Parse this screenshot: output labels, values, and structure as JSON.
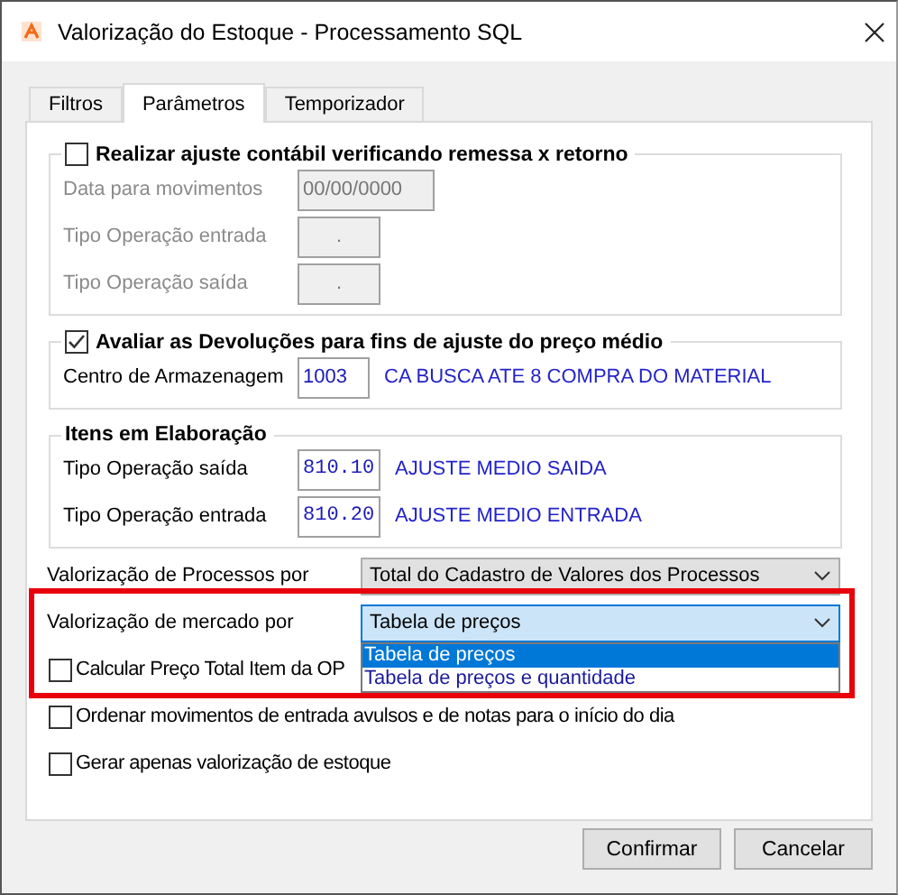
{
  "window": {
    "title": "Valorização do Estoque - Processamento SQL"
  },
  "tabs": [
    {
      "label": "Filtros",
      "selected": false
    },
    {
      "label": "Parâmetros",
      "selected": true
    },
    {
      "label": "Temporizador",
      "selected": false
    }
  ],
  "groups": [
    {
      "kind": "check",
      "title": "Realizar ajuste contábil verificando remessa x retorno",
      "checked": false,
      "fields": [
        {
          "kind": "date",
          "label": "Data para movimentos",
          "value": "00/00/0000",
          "disabled": true
        },
        {
          "kind": "code",
          "label": "Tipo Operação entrada",
          "value": ".",
          "disabled": true
        },
        {
          "kind": "code",
          "label": "Tipo Operação saída",
          "value": ".",
          "disabled": true
        }
      ]
    },
    {
      "kind": "check",
      "title": "Avaliar as Devoluções para fins de ajuste do preço médio",
      "checked": true,
      "fields": [
        {
          "kind": "number",
          "label": "Centro de Armazenagem",
          "value": "1003",
          "note": "CA BUSCA ATE 8 COMPRA DO MATERIAL",
          "disabled": false
        }
      ]
    },
    {
      "kind": "plain",
      "title": "Itens em Elaboração",
      "fields": [
        {
          "kind": "code",
          "label": "Tipo Operação saída",
          "value": "810.10",
          "note": "AJUSTE MEDIO SAIDA",
          "disabled": false
        },
        {
          "kind": "code",
          "label": "Tipo Operação entrada",
          "value": "810.20",
          "note": "AJUSTE MEDIO ENTRADA",
          "disabled": false
        }
      ]
    }
  ],
  "combos": [
    {
      "label": "Valorização de Processos por",
      "value": "Total do Cadastro de Valores dos Processos",
      "open": false,
      "highlighted": false
    },
    {
      "label": "Valorização de mercado por",
      "value": "Tabela de preços",
      "open": true,
      "highlighted": true,
      "options": [
        {
          "label": "Tabela de preços",
          "selected": true
        },
        {
          "label": "Tabela de preços e quantidade",
          "selected": false
        }
      ]
    }
  ],
  "checkboxes": [
    {
      "label": "Calcular Preço Total Item da OP",
      "checked": false
    },
    {
      "label": "Ordenar movimentos de entrada avulsos e de notas para o início do dia",
      "checked": false
    },
    {
      "label": "Gerar apenas valorização de estoque",
      "checked": false
    }
  ],
  "buttons": [
    "Confirmar",
    "Cancelar"
  ]
}
